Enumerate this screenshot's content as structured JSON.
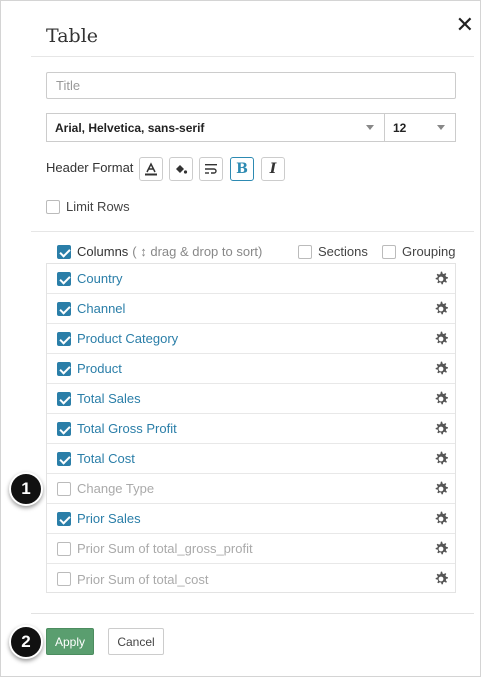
{
  "dialog": {
    "title": "Table",
    "close_glyph": "✕"
  },
  "title_input": {
    "placeholder": "Title",
    "value": ""
  },
  "font_select": {
    "value": "Arial, Helvetica, sans-serif"
  },
  "size_select": {
    "value": "12"
  },
  "header_format": {
    "label": "Header Format",
    "buttons": [
      {
        "name": "text-color-icon",
        "glyph": "A"
      },
      {
        "name": "fill-color-icon",
        "glyph": "◆"
      },
      {
        "name": "wrap-text-icon",
        "glyph": "≡"
      },
      {
        "name": "bold-icon",
        "glyph": "B",
        "active": true
      },
      {
        "name": "italic-icon",
        "glyph": "I"
      }
    ]
  },
  "limit_rows": {
    "label": "Limit Rows",
    "checked": false
  },
  "columns_header": {
    "label": "Columns",
    "hint": "( ↕ drag & drop to sort)",
    "sections_label": "Sections",
    "grouping_label": "Grouping"
  },
  "columns": [
    {
      "label": "Country",
      "checked": true
    },
    {
      "label": "Channel",
      "checked": true
    },
    {
      "label": "Product Category",
      "checked": true
    },
    {
      "label": "Product",
      "checked": true
    },
    {
      "label": "Total Sales",
      "checked": true
    },
    {
      "label": "Total Gross Profit",
      "checked": true
    },
    {
      "label": "Total Cost",
      "checked": true
    },
    {
      "label": "Change Type",
      "checked": false
    },
    {
      "label": "Prior Sales",
      "checked": true
    },
    {
      "label": "Prior Sum of total_gross_profit",
      "checked": false
    },
    {
      "label": "Prior Sum of total_cost",
      "checked": false
    }
  ],
  "badges": {
    "one": "1",
    "two": "2"
  },
  "footer": {
    "apply_label": "Apply",
    "cancel_label": "Cancel"
  },
  "colors": {
    "accent": "#2a7ea8",
    "apply_green": "#5a9e6f"
  }
}
